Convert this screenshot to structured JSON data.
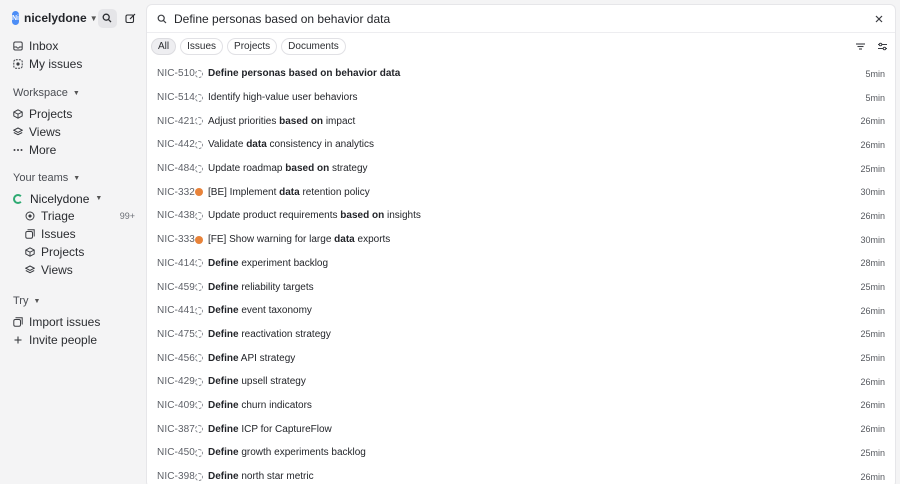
{
  "workspace": {
    "name": "nicelydone",
    "initials": "Ni"
  },
  "nav_top": [
    {
      "label": "Inbox",
      "icon": "inbox-icon"
    },
    {
      "label": "My issues",
      "icon": "my-issues-icon"
    }
  ],
  "workspace_section": {
    "label": "Workspace",
    "items": [
      {
        "label": "Projects",
        "icon": "projects-icon"
      },
      {
        "label": "Views",
        "icon": "views-icon"
      },
      {
        "label": "More",
        "icon": "more-icon"
      }
    ]
  },
  "teams_section": {
    "label": "Your teams",
    "team_name": "Nicelydone",
    "items": [
      {
        "label": "Triage",
        "icon": "triage-icon",
        "count": "99+"
      },
      {
        "label": "Issues",
        "icon": "issues-icon"
      },
      {
        "label": "Projects",
        "icon": "projects-icon"
      },
      {
        "label": "Views",
        "icon": "views-icon"
      }
    ]
  },
  "try_section": {
    "label": "Try",
    "items": [
      {
        "label": "Import issues",
        "icon": "import-icon"
      },
      {
        "label": "Invite people",
        "icon": "plus-icon"
      }
    ]
  },
  "search": {
    "value": "Define personas based on behavior data"
  },
  "filters": [
    "All",
    "Issues",
    "Projects",
    "Documents"
  ],
  "results": [
    {
      "id": "NIC-510",
      "parts": [
        [
          "Define personas based on behavior data",
          true
        ]
      ],
      "time": "5min",
      "status": "dashed"
    },
    {
      "id": "NIC-514",
      "parts": [
        [
          "Identify high-value user behaviors",
          false
        ]
      ],
      "time": "5min",
      "status": "dashed"
    },
    {
      "id": "NIC-421",
      "parts": [
        [
          "Adjust priorities ",
          false
        ],
        [
          "based on",
          true
        ],
        [
          " impact",
          false
        ]
      ],
      "time": "26min",
      "status": "dashed"
    },
    {
      "id": "NIC-442",
      "parts": [
        [
          "Validate ",
          false
        ],
        [
          "data",
          true
        ],
        [
          " consistency in analytics",
          false
        ]
      ],
      "time": "26min",
      "status": "dashed"
    },
    {
      "id": "NIC-484",
      "parts": [
        [
          "Update roadmap ",
          false
        ],
        [
          "based on",
          true
        ],
        [
          " strategy",
          false
        ]
      ],
      "time": "25min",
      "status": "dashed"
    },
    {
      "id": "NIC-332",
      "parts": [
        [
          "[BE] Implement ",
          false
        ],
        [
          "data",
          true
        ],
        [
          " retention policy",
          false
        ]
      ],
      "time": "30min",
      "status": "avatar"
    },
    {
      "id": "NIC-438",
      "parts": [
        [
          "Update product requirements ",
          false
        ],
        [
          "based on",
          true
        ],
        [
          " insights",
          false
        ]
      ],
      "time": "26min",
      "status": "dashed"
    },
    {
      "id": "NIC-333",
      "parts": [
        [
          "[FE] Show warning for large ",
          false
        ],
        [
          "data",
          true
        ],
        [
          " exports",
          false
        ]
      ],
      "time": "30min",
      "status": "avatar"
    },
    {
      "id": "NIC-414",
      "parts": [
        [
          "Define",
          true
        ],
        [
          " experiment backlog",
          false
        ]
      ],
      "time": "28min",
      "status": "dashed"
    },
    {
      "id": "NIC-459",
      "parts": [
        [
          "Define",
          true
        ],
        [
          " reliability targets",
          false
        ]
      ],
      "time": "25min",
      "status": "dashed"
    },
    {
      "id": "NIC-441",
      "parts": [
        [
          "Define",
          true
        ],
        [
          " event taxonomy",
          false
        ]
      ],
      "time": "26min",
      "status": "dashed"
    },
    {
      "id": "NIC-475",
      "parts": [
        [
          "Define",
          true
        ],
        [
          " reactivation strategy",
          false
        ]
      ],
      "time": "25min",
      "status": "dashed"
    },
    {
      "id": "NIC-456",
      "parts": [
        [
          "Define",
          true
        ],
        [
          " API strategy",
          false
        ]
      ],
      "time": "25min",
      "status": "dashed"
    },
    {
      "id": "NIC-429",
      "parts": [
        [
          "Define",
          true
        ],
        [
          " upsell strategy",
          false
        ]
      ],
      "time": "26min",
      "status": "dashed"
    },
    {
      "id": "NIC-409",
      "parts": [
        [
          "Define",
          true
        ],
        [
          " churn indicators",
          false
        ]
      ],
      "time": "26min",
      "status": "dashed"
    },
    {
      "id": "NIC-387",
      "parts": [
        [
          "Define",
          true
        ],
        [
          " ICP for CaptureFlow",
          false
        ]
      ],
      "time": "26min",
      "status": "dashed"
    },
    {
      "id": "NIC-450",
      "parts": [
        [
          "Define",
          true
        ],
        [
          " growth experiments backlog",
          false
        ]
      ],
      "time": "25min",
      "status": "dashed"
    },
    {
      "id": "NIC-398",
      "parts": [
        [
          "Define",
          true
        ],
        [
          " north star metric",
          false
        ]
      ],
      "time": "26min",
      "status": "dashed"
    }
  ]
}
